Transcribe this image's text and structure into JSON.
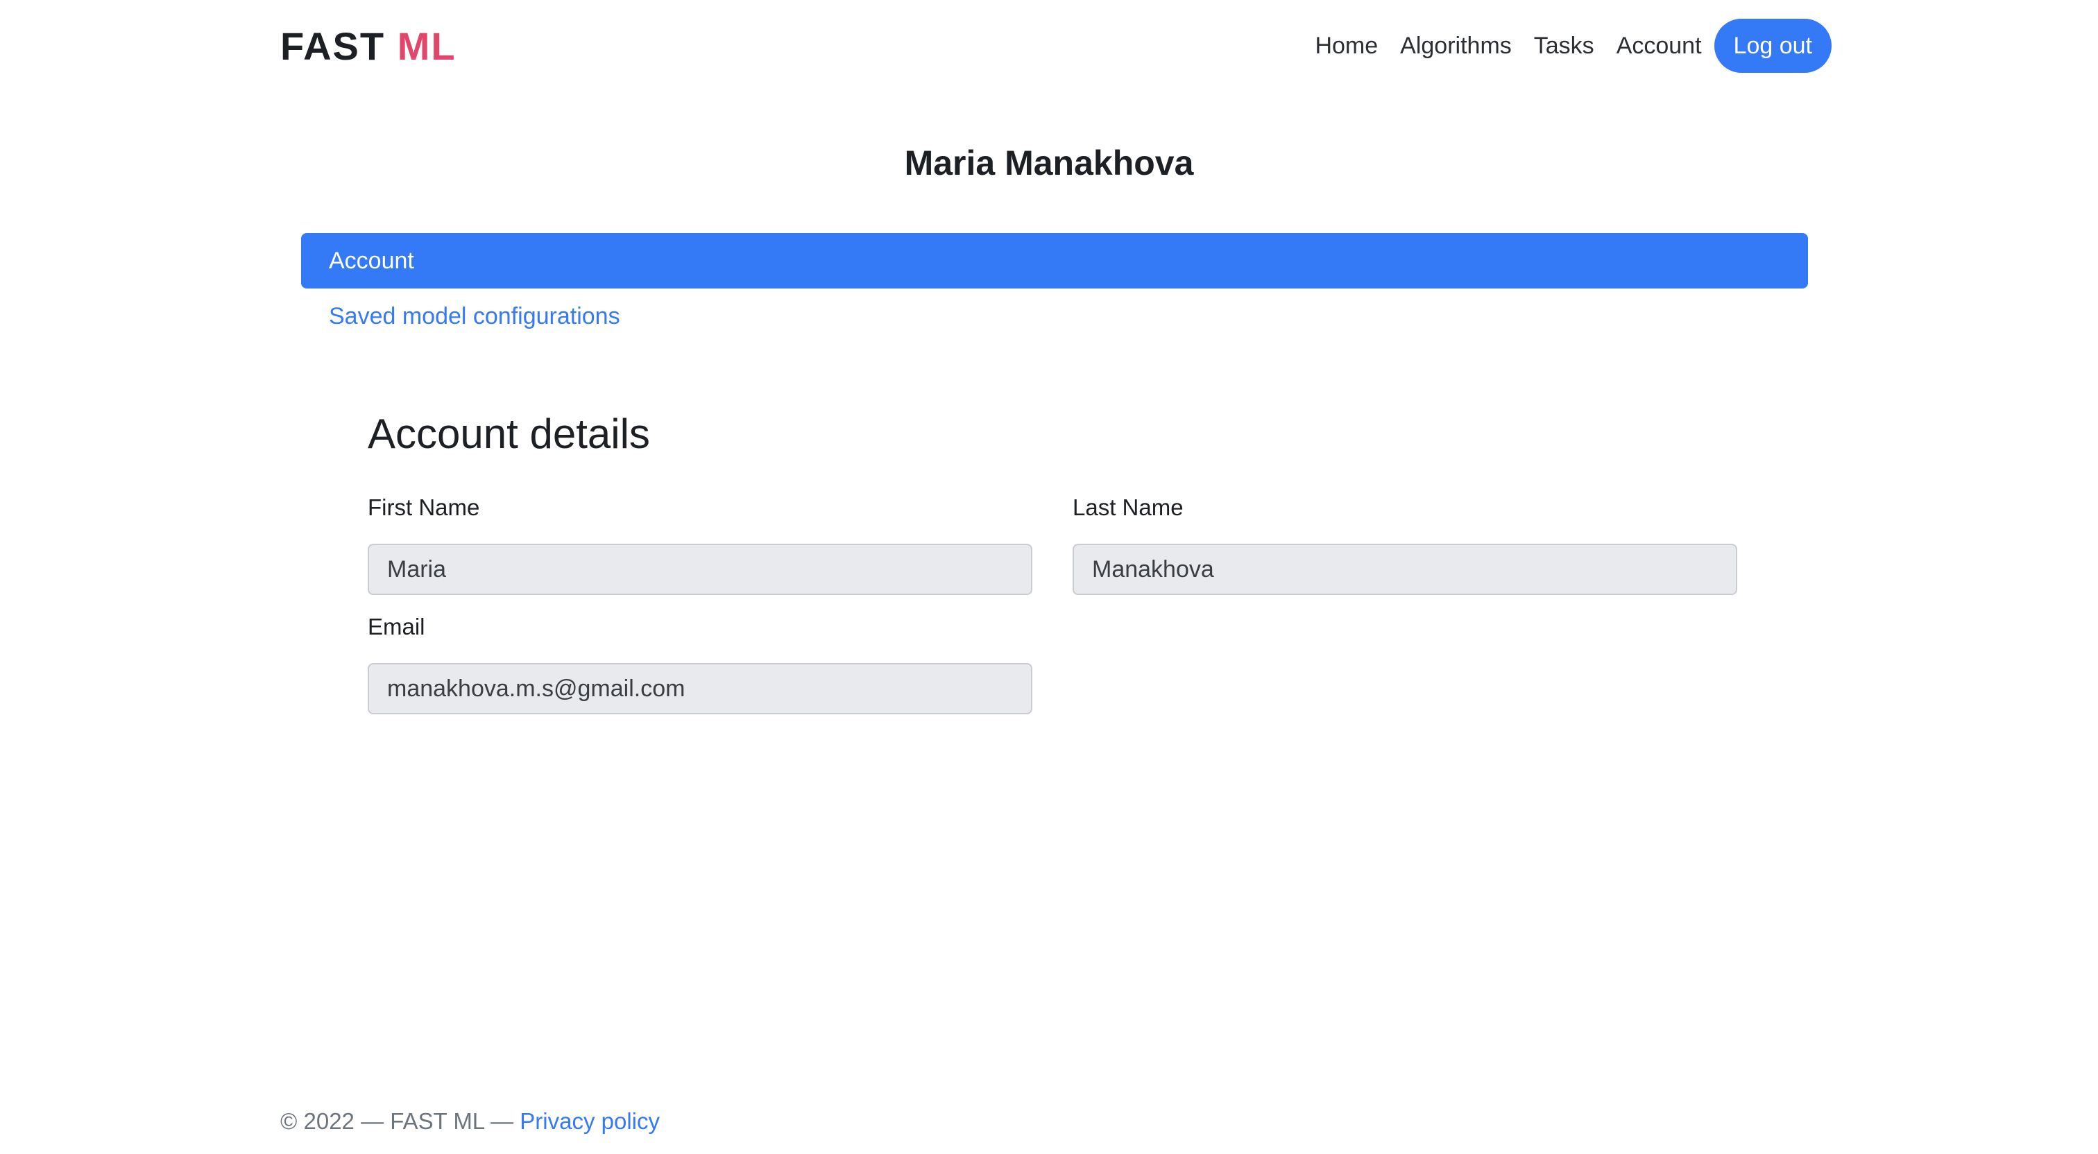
{
  "header": {
    "logo_main": "FAST",
    "logo_accent": "ML",
    "nav": {
      "home": "Home",
      "algorithms": "Algorithms",
      "tasks": "Tasks",
      "account": "Account"
    },
    "logout_label": "Log out"
  },
  "profile": {
    "name": "Maria Manakhova"
  },
  "tabs": {
    "account": "Account",
    "saved_configs": "Saved model configurations"
  },
  "details": {
    "heading": "Account details",
    "first_name_label": "First Name",
    "first_name_value": "Maria",
    "last_name_label": "Last Name",
    "last_name_value": "Manakhova",
    "email_label": "Email",
    "email_value": "manakhova.m.s@gmail.com"
  },
  "footer": {
    "copyright": "© 2022 — FAST ML — ",
    "privacy_link": "Privacy policy"
  },
  "colors": {
    "primary": "#3479f5",
    "logo_accent": "#e2476b",
    "input_bg": "#e9eaed"
  }
}
